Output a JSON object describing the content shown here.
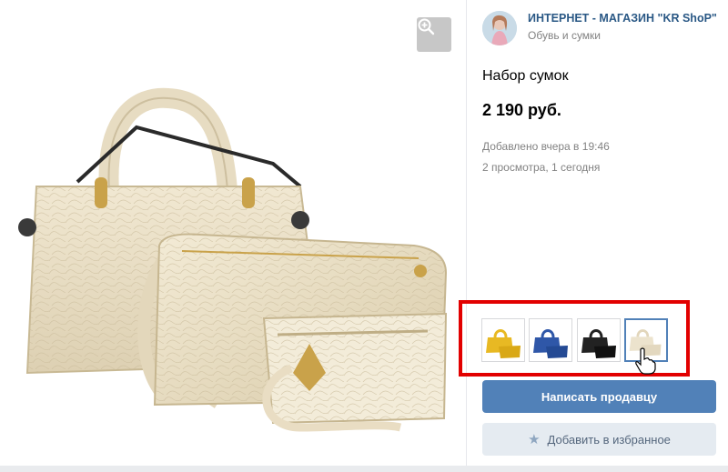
{
  "seller": {
    "name": "ИНТЕРНЕТ - МАГАЗИН \"KR ShoP\"",
    "category": "Обувь и сумки",
    "avatar_icon": "woman-avatar-icon"
  },
  "product": {
    "title": "Набор сумок",
    "price": "2 190 руб.",
    "added": "Добавлено вчера в 19:46",
    "views": "2 просмотра, 1 сегодня"
  },
  "gallery": {
    "zoom_icon": "zoom-in-icon",
    "thumbnails": [
      {
        "color": "yellow",
        "fill": "#e8b923"
      },
      {
        "color": "blue",
        "fill": "#2f57a8"
      },
      {
        "color": "black",
        "fill": "#222222"
      },
      {
        "color": "beige",
        "fill": "#ece3cd",
        "selected": true
      }
    ]
  },
  "actions": {
    "message_label": "Написать продавцу",
    "favorite_label": "Добавить в избранное",
    "favorite_icon": "star-icon"
  },
  "colors": {
    "accent": "#5181b8",
    "link": "#2a5885",
    "highlight": "#e20000",
    "muted": "#828282"
  }
}
